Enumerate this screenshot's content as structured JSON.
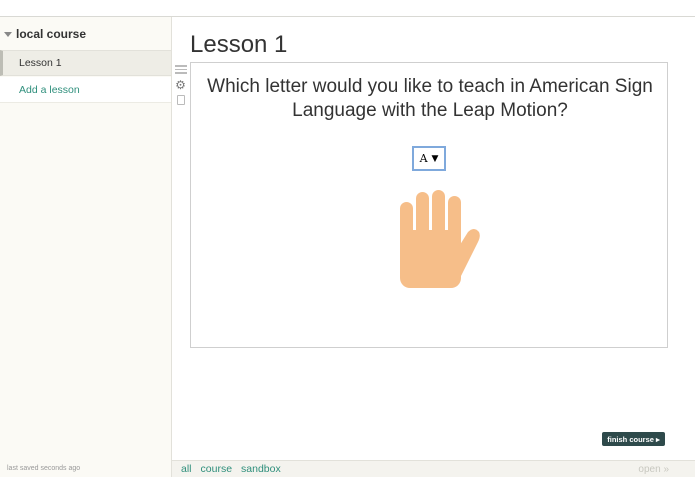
{
  "sidebar": {
    "course_title": "local course",
    "lessons": [
      {
        "label": "Lesson 1"
      }
    ],
    "add_lesson_label": "Add a lesson",
    "last_saved": "last saved seconds ago"
  },
  "main": {
    "lesson_title": "Lesson 1",
    "question": "Which letter would you like to teach in American Sign Language with the Leap Motion?",
    "letter_select": {
      "selected": "A",
      "arrow": "▼"
    },
    "finish_button_label": "finish course",
    "finish_button_arrow": "▸"
  },
  "bottom_nav": {
    "links": [
      "all",
      "course",
      "sandbox"
    ],
    "open_label": "open",
    "open_icon": "»"
  },
  "colors": {
    "accent_link": "#2f8f7c",
    "hand_skin": "#f6be89",
    "finish_button_bg": "#2e4a4b",
    "select_border": "#7fa9dc"
  }
}
